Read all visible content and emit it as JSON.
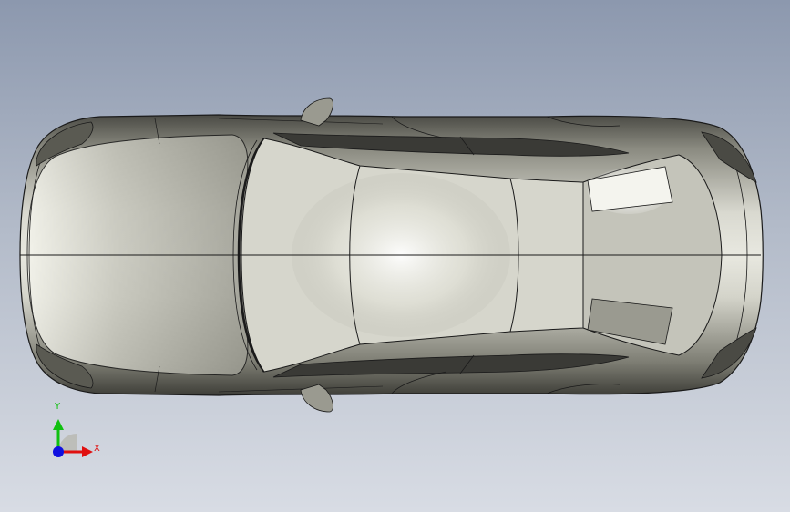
{
  "viewport": {
    "background_top": "#8c98ae",
    "background_bottom": "#d8dce4"
  },
  "model": {
    "body_color": "#b8b8b0",
    "edge_color": "#1a1a1a",
    "window_color": "#3a3a36"
  },
  "triad": {
    "x_label": "X",
    "y_label": "Y",
    "x_color": "#e01010",
    "y_color": "#10c010",
    "z_color": "#1010e0"
  }
}
